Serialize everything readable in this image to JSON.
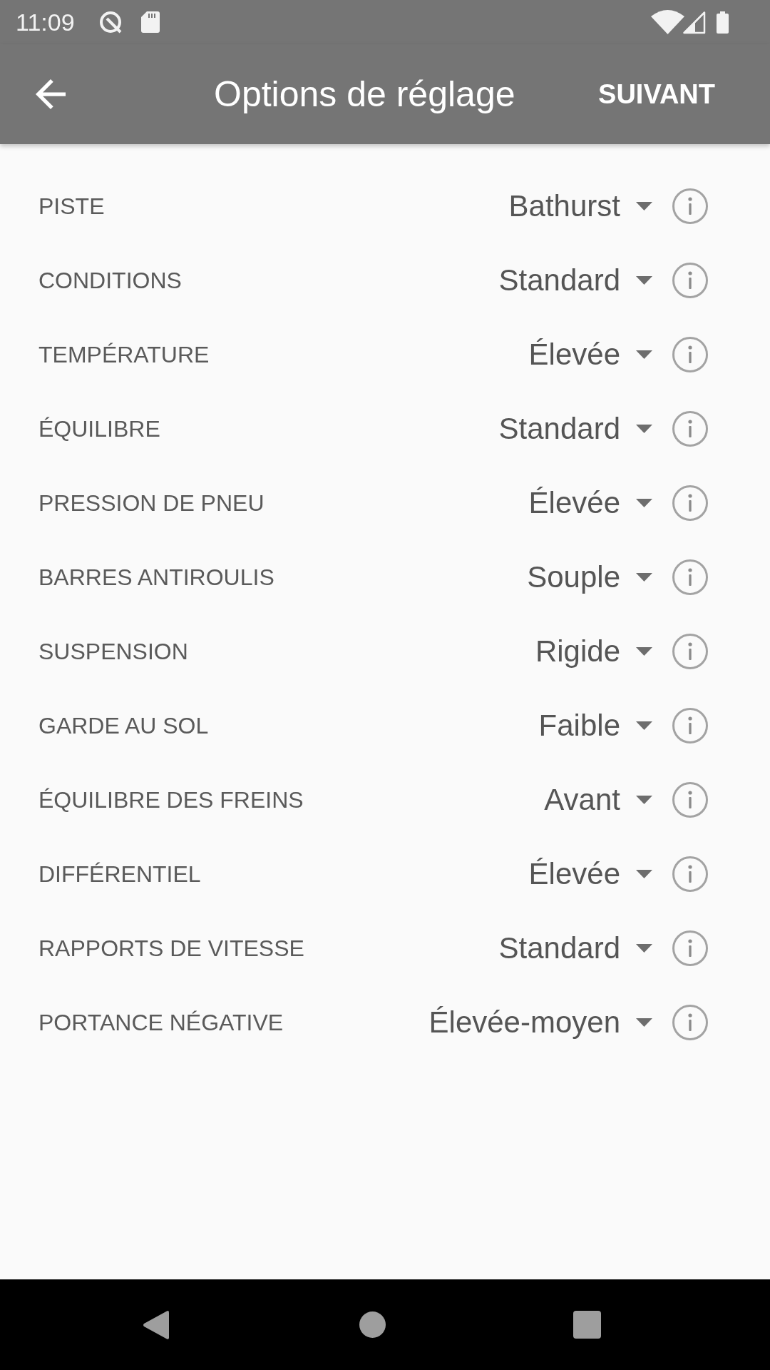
{
  "status_bar": {
    "time": "11:09"
  },
  "app_bar": {
    "title": "Options de réglage",
    "action": "SUIVANT"
  },
  "settings": [
    {
      "label": "PISTE",
      "value": "Bathurst"
    },
    {
      "label": "CONDITIONS",
      "value": "Standard"
    },
    {
      "label": "TEMPÉRATURE",
      "value": "Élevée"
    },
    {
      "label": "ÉQUILIBRE",
      "value": "Standard"
    },
    {
      "label": "PRESSION DE PNEU",
      "value": "Élevée"
    },
    {
      "label": "BARRES ANTIROULIS",
      "value": "Souple"
    },
    {
      "label": "SUSPENSION",
      "value": "Rigide"
    },
    {
      "label": "GARDE AU SOL",
      "value": "Faible"
    },
    {
      "label": "ÉQUILIBRE DES FREINS",
      "value": "Avant"
    },
    {
      "label": "DIFFÉRENTIEL",
      "value": "Élevée"
    },
    {
      "label": "RAPPORTS DE VITESSE",
      "value": "Standard"
    },
    {
      "label": "PORTANCE NÉGATIVE",
      "value": "Élevée-moyen"
    }
  ]
}
